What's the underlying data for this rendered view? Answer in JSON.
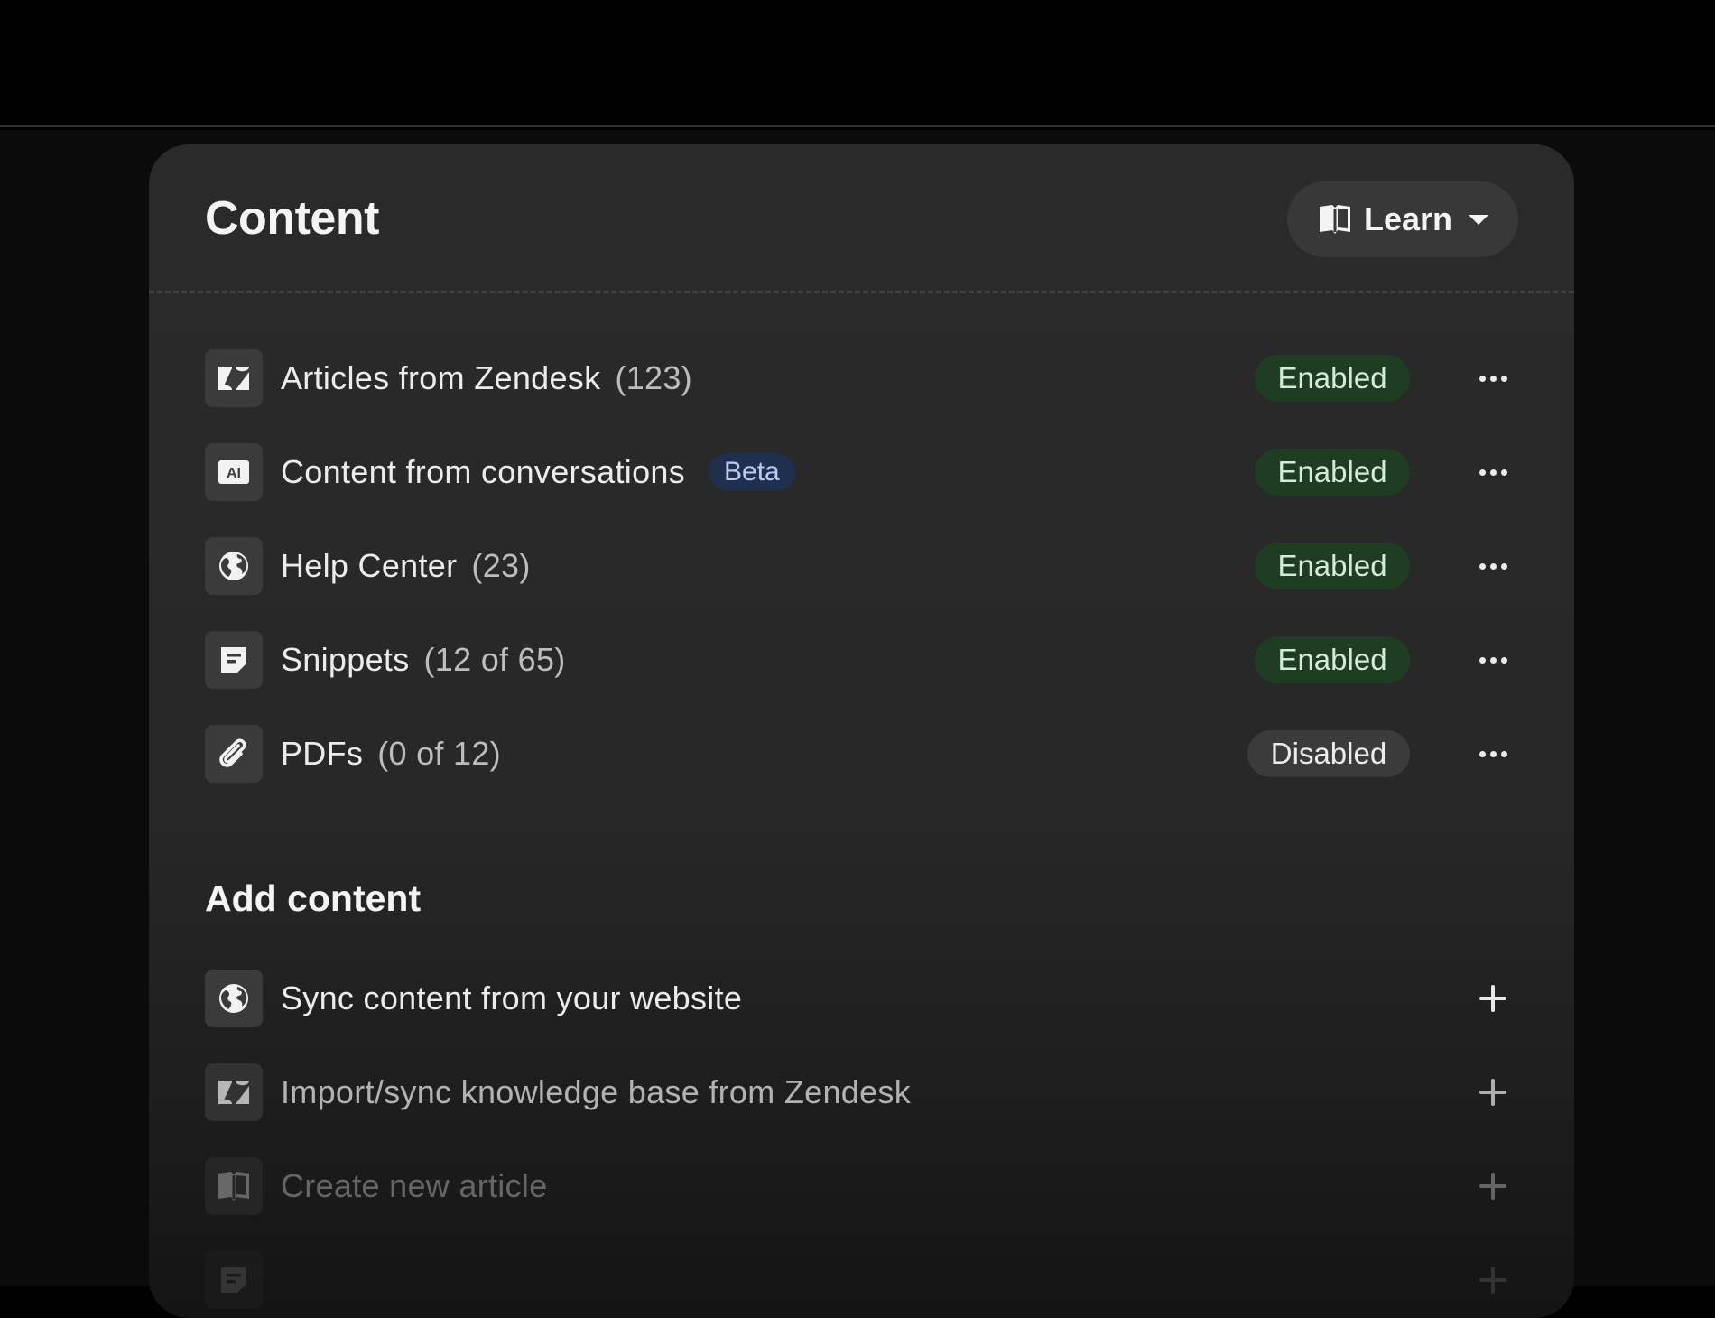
{
  "header": {
    "title": "Content",
    "learn_label": "Learn"
  },
  "content_sources": [
    {
      "icon": "zendesk-icon",
      "label": "Articles from Zendesk",
      "count": "(123)",
      "badge": "",
      "status": "Enabled"
    },
    {
      "icon": "ai-icon",
      "label": "Content from conversations",
      "count": "",
      "badge": "Beta",
      "status": "Enabled"
    },
    {
      "icon": "globe-icon",
      "label": "Help Center",
      "count": "(23)",
      "badge": "",
      "status": "Enabled"
    },
    {
      "icon": "snippet-icon",
      "label": "Snippets",
      "count": "(12 of 65)",
      "badge": "",
      "status": "Enabled"
    },
    {
      "icon": "paperclip-icon",
      "label": "PDFs",
      "count": "(0 of 12)",
      "badge": "",
      "status": "Disabled"
    }
  ],
  "add_content": {
    "title": "Add content",
    "items": [
      {
        "icon": "globe-icon",
        "label": "Sync content from your website"
      },
      {
        "icon": "zendesk-icon",
        "label": "Import/sync knowledge base from Zendesk"
      },
      {
        "icon": "book-icon",
        "label": "Create new article"
      },
      {
        "icon": "snippet-icon",
        "label": ""
      }
    ]
  },
  "colors": {
    "enabled_bg": "#1f3d22",
    "enabled_text": "#d4ecd5",
    "beta_bg": "#1f2f4d",
    "beta_text": "#b7cdf5",
    "panel_bg": "#2a2a2a"
  }
}
